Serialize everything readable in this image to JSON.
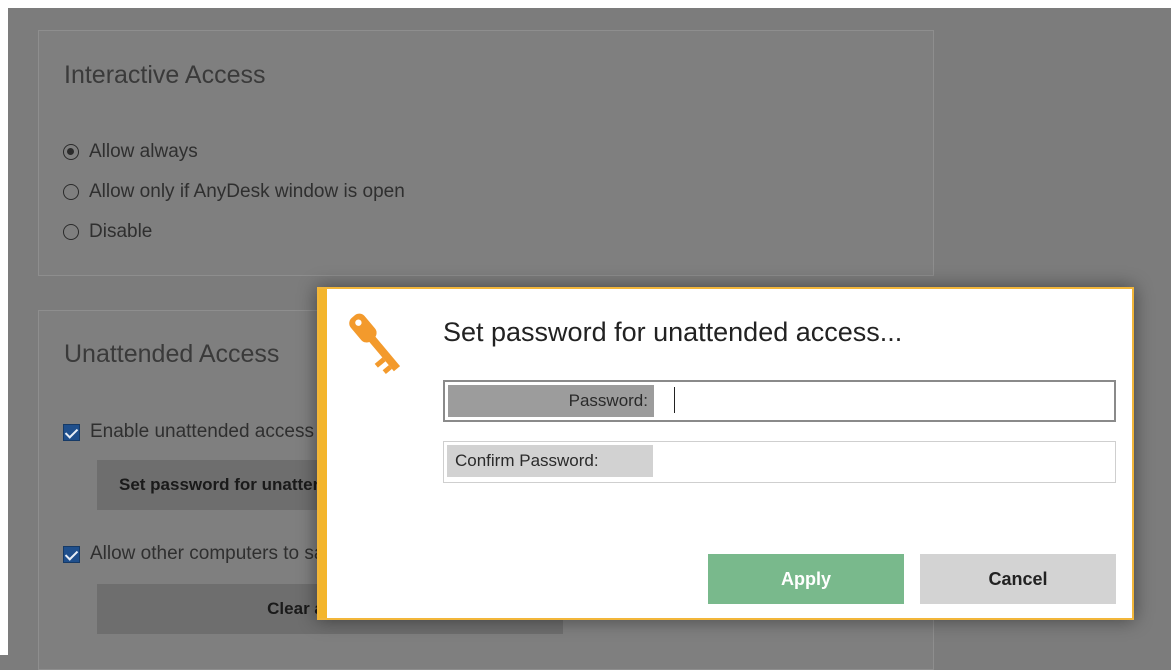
{
  "interactive_access": {
    "title": "Interactive Access",
    "options": [
      "Allow always",
      "Allow only if AnyDesk window is open",
      "Disable"
    ],
    "selected": "Allow always"
  },
  "unattended_access": {
    "title": "Unattended Access",
    "enable_label": "Enable unattended access",
    "set_password_button": "Set password for unattended access...",
    "allow_other_label": "Allow other computers to save login information for this computer",
    "clear_button": "Clear all tokens"
  },
  "dialog": {
    "title": "Set password for unattended access...",
    "password_label": "Password:",
    "password_value": "",
    "confirm_label": "Confirm Password:",
    "confirm_value": "",
    "apply_label": "Apply",
    "cancel_label": "Cancel",
    "icon": "key-icon",
    "accent_color": "#f3b52c",
    "apply_color": "#79b98c"
  }
}
